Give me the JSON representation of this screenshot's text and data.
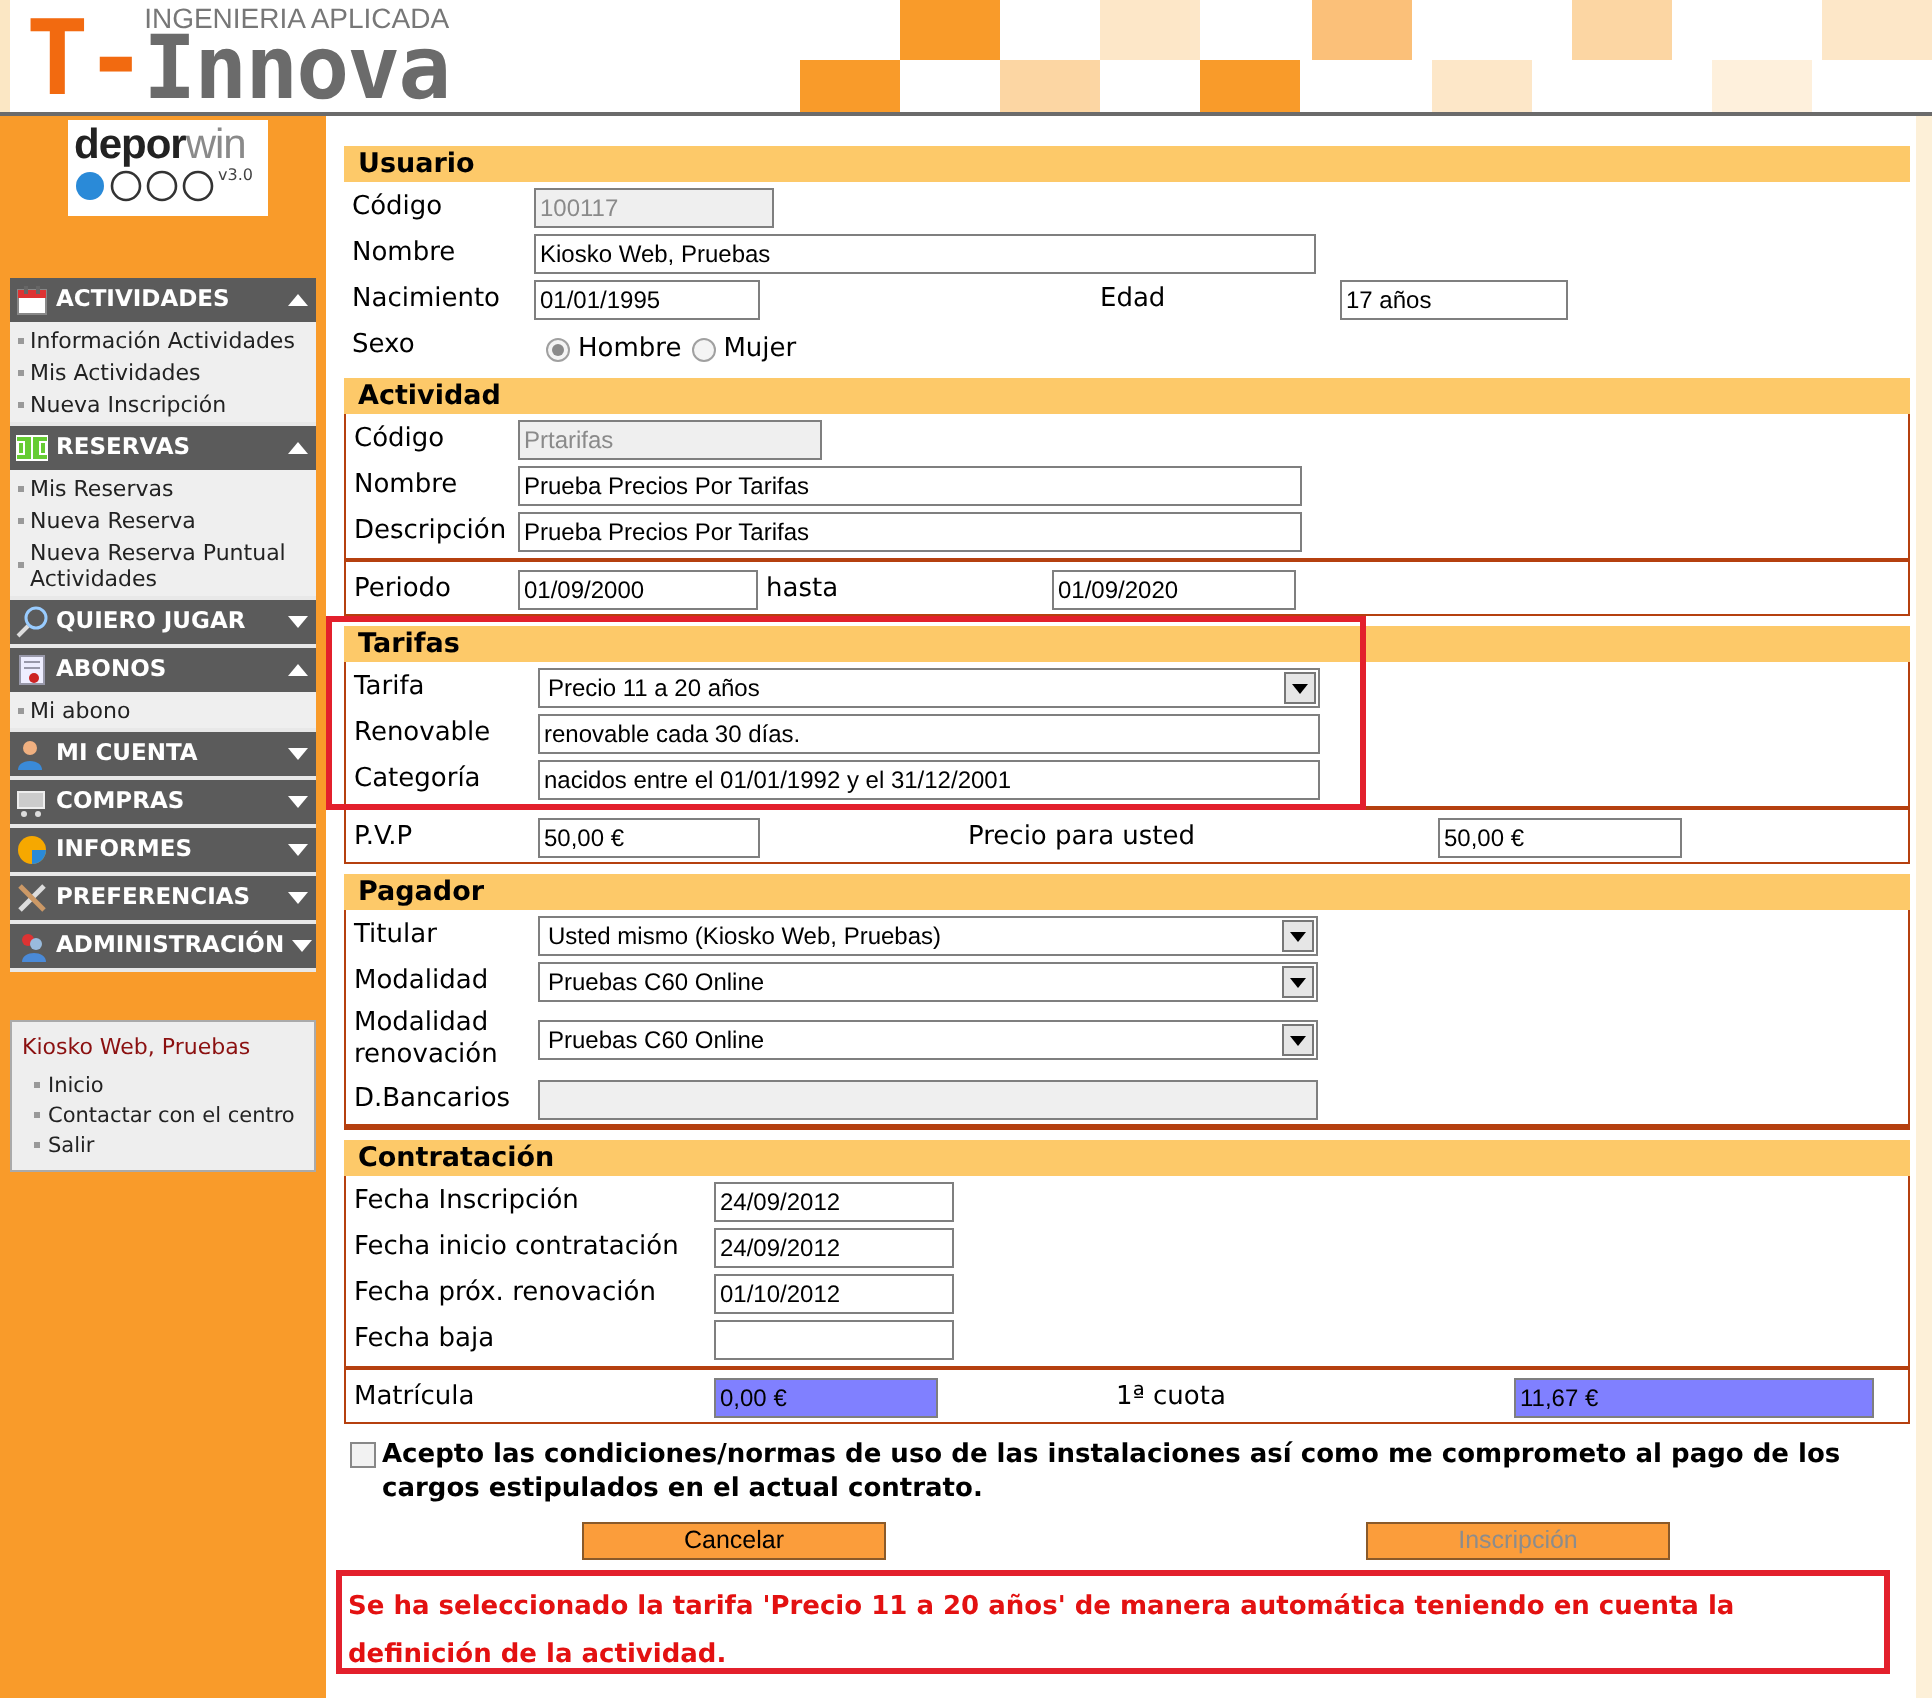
{
  "header": {
    "logo_prefix": "T-",
    "logo_word": "Innova",
    "tagline": "INGENIERIA APLICADA"
  },
  "sidebar": {
    "app_logo": {
      "name_part1": "depor",
      "name_part2": "win",
      "version": "v3.0"
    },
    "menus": [
      {
        "title": "ACTIVIDADES",
        "expanded": true,
        "items": [
          "Información Actividades",
          "Mis Actividades",
          "Nueva Inscripción"
        ]
      },
      {
        "title": "RESERVAS",
        "expanded": true,
        "items": [
          "Mis Reservas",
          "Nueva Reserva",
          "Nueva Reserva Puntual Actividades"
        ]
      },
      {
        "title": "QUIERO JUGAR",
        "expanded": false
      },
      {
        "title": "ABONOS",
        "expanded": true,
        "items": [
          "Mi abono"
        ]
      },
      {
        "title": "MI CUENTA",
        "expanded": false
      },
      {
        "title": "COMPRAS",
        "expanded": false
      },
      {
        "title": "INFORMES",
        "expanded": false
      },
      {
        "title": "PREFERENCIAS",
        "expanded": false
      },
      {
        "title": "ADMINISTRACIÓN",
        "expanded": false
      }
    ],
    "user_box": {
      "user": "Kiosko Web, Pruebas",
      "links": [
        "Inicio",
        "Contactar con el centro",
        "Salir"
      ]
    }
  },
  "form": {
    "sections": [
      {
        "title": "Usuario",
        "boxed": false,
        "groups": [
          [
            [
              {
                "kind": "input",
                "label": "Código",
                "value": "100117",
                "disabled": true
              }
            ],
            [
              {
                "kind": "input",
                "label": "Nombre",
                "value": "Kiosko Web, Pruebas",
                "disabled": false
              }
            ],
            [
              {
                "kind": "input",
                "label": "Nacimiento",
                "value": "01/01/1995",
                "disabled": false
              },
              {
                "kind": "input",
                "label": "Edad",
                "value": "17 años",
                "disabled": false
              }
            ],
            [
              {
                "kind": "radio",
                "label": "Sexo",
                "options": [
                  {
                    "label": "Hombre",
                    "selected": true
                  },
                  {
                    "label": "Mujer",
                    "selected": false
                  }
                ]
              }
            ]
          ]
        ]
      },
      {
        "title": "Actividad",
        "boxed": true,
        "groups": [
          [
            [
              {
                "kind": "input",
                "label": "Código",
                "value": "Prtarifas",
                "disabled": true
              }
            ],
            [
              {
                "kind": "input",
                "label": "Nombre",
                "value": "Prueba Precios Por Tarifas",
                "disabled": false
              }
            ],
            [
              {
                "kind": "input",
                "label": "Descripción",
                "value": "Prueba Precios Por Tarifas",
                "disabled": false
              }
            ]
          ],
          [
            [
              {
                "kind": "input",
                "label": "Periodo",
                "value": "01/09/2000",
                "disabled": false
              },
              {
                "kind": "input",
                "label": "hasta",
                "value": "01/09/2020",
                "disabled": false
              }
            ]
          ]
        ]
      },
      {
        "title": "Tarifas",
        "boxed": true,
        "highlighted": true,
        "groups": [
          [
            [
              {
                "kind": "select",
                "label": "Tarifa",
                "value": "Precio 11 a 20 años"
              }
            ],
            [
              {
                "kind": "input",
                "label": "Renovable",
                "value": "renovable cada 30 días.",
                "disabled": false
              }
            ],
            [
              {
                "kind": "input",
                "label": "Categoría",
                "value": "nacidos entre el 01/01/1992 y el 31/12/2001",
                "disabled": false
              }
            ]
          ],
          [
            [
              {
                "kind": "input",
                "label": "P.V.P",
                "value": "50,00 €",
                "disabled": false
              },
              {
                "kind": "input",
                "label": "Precio para usted",
                "value": "50,00 €",
                "disabled": false
              }
            ]
          ]
        ]
      },
      {
        "title": "Pagador",
        "boxed": true,
        "groups": [
          [
            [
              {
                "kind": "select",
                "label": "Titular",
                "value": "Usted mismo (Kiosko Web, Pruebas)"
              }
            ],
            [
              {
                "kind": "select",
                "label": "Modalidad",
                "value": "Pruebas C60 Online"
              }
            ],
            [
              {
                "kind": "select",
                "label": "Modalidad renovación",
                "value": "Pruebas C60 Online"
              }
            ],
            [
              {
                "kind": "input",
                "label": "D.Bancarios",
                "disabled": true
              }
            ]
          ]
        ]
      },
      {
        "title": "Contratación",
        "boxed": true,
        "groups": [
          [
            [
              {
                "kind": "input",
                "label": "Fecha Inscripción",
                "value": "24/09/2012",
                "disabled": false
              }
            ],
            [
              {
                "kind": "input",
                "label": "Fecha inicio contratación",
                "value": "24/09/2012",
                "disabled": false
              }
            ],
            [
              {
                "kind": "input",
                "label": "Fecha próx. renovación",
                "value": "01/10/2012",
                "disabled": false
              }
            ],
            [
              {
                "kind": "input",
                "label": "Fecha baja",
                "disabled": false
              }
            ]
          ],
          [
            [
              {
                "kind": "input",
                "label": "Matrícula",
                "value": "0,00 €",
                "disabled": false,
                "color": "#8080ff"
              },
              {
                "kind": "input",
                "label": "1ª cuota",
                "value": "11,67 €",
                "disabled": false,
                "color": "#8080ff"
              }
            ]
          ]
        ]
      }
    ]
  },
  "acceptance": {
    "checked": false,
    "text": "Acepto las condiciones/normas de uso de las instalaciones así como me comprometo al pago de los cargos estipulados en el actual contrato."
  },
  "buttons": [
    {
      "label": "Cancelar",
      "disabled": false
    },
    {
      "label": "Inscripción",
      "disabled": true
    }
  ],
  "message": "Se ha seleccionado la tarifa 'Precio 11 a 20 años' de manera automática teniendo en cuenta la definición de la actividad."
}
